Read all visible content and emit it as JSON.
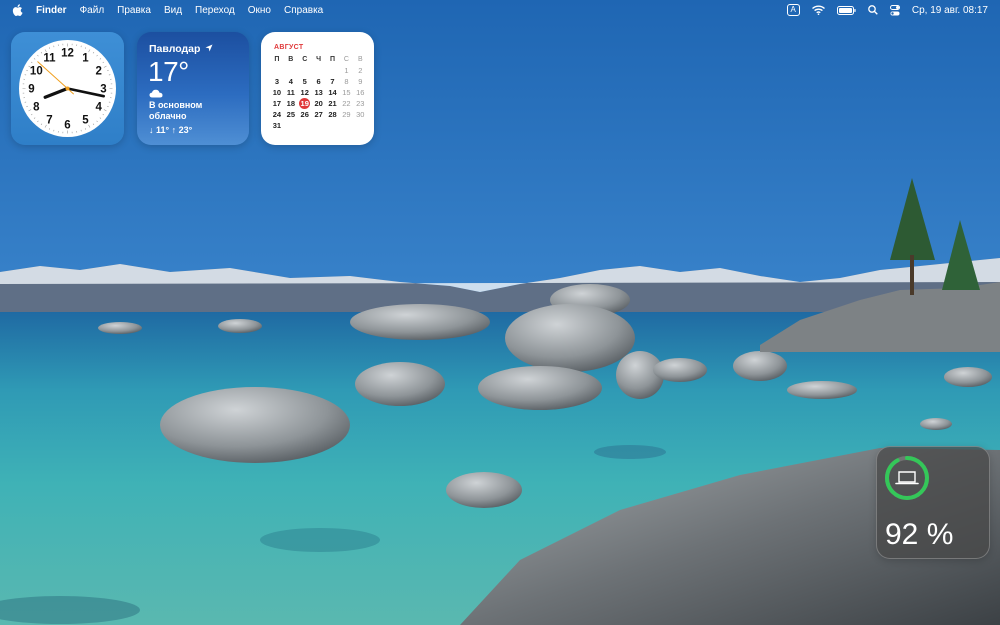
{
  "menubar": {
    "app_name": "Finder",
    "menus": [
      "Файл",
      "Правка",
      "Вид",
      "Переход",
      "Окно",
      "Справка"
    ],
    "input_source": "A",
    "datetime": "Ср, 19 авг.  08:17"
  },
  "clock_widget": {
    "numbers": [
      "12",
      "1",
      "2",
      "3",
      "4",
      "5",
      "6",
      "7",
      "8",
      "9",
      "10",
      "11"
    ],
    "time": "08:17"
  },
  "weather_widget": {
    "city": "Павлодар",
    "temperature": "17°",
    "condition": "В основном облачно",
    "range": "↓ 11° ↑ 23°"
  },
  "calendar_widget": {
    "month": "АВГУСТ",
    "weekday_headers": [
      "П",
      "В",
      "С",
      "Ч",
      "П",
      "С",
      "В"
    ],
    "leading_blanks": 5,
    "days": [
      "1",
      "2",
      "3",
      "4",
      "5",
      "6",
      "7",
      "8",
      "9",
      "10",
      "11",
      "12",
      "13",
      "14",
      "15",
      "16",
      "17",
      "18",
      "19",
      "20",
      "21",
      "22",
      "23",
      "24",
      "25",
      "26",
      "27",
      "28",
      "29",
      "30",
      "31"
    ],
    "today": "19"
  },
  "battery_widget": {
    "percent": "92 %",
    "level": 0.92
  },
  "colors": {
    "calendar_accent": "#e0393a",
    "battery_ring": "#34c759"
  }
}
